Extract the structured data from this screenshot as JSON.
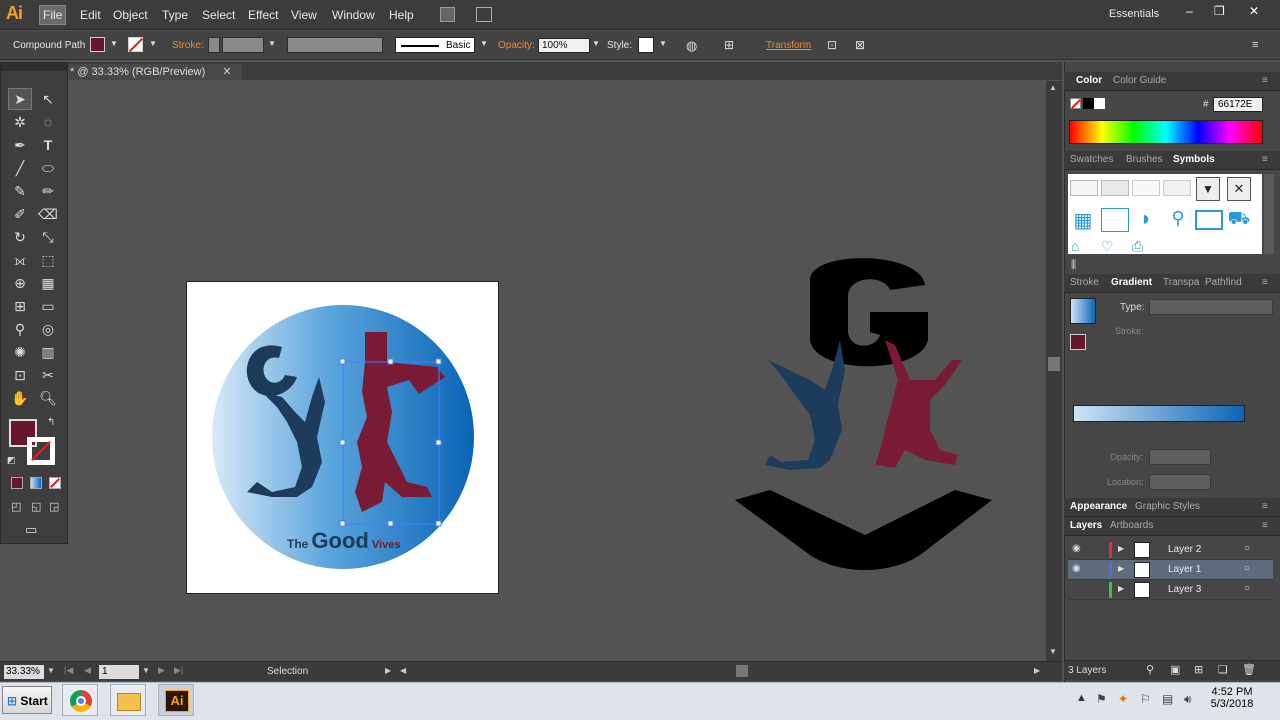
{
  "app": {
    "logo": "Ai"
  },
  "menu": {
    "items": [
      "File",
      "Edit",
      "Object",
      "Type",
      "Select",
      "Effect",
      "View",
      "Window",
      "Help"
    ],
    "workspace": "Essentials"
  },
  "control": {
    "selection_type": "Compound Path",
    "stroke_label": "Stroke:",
    "brush": "Basic",
    "opacity_label": "Opacity:",
    "opacity_value": "100%",
    "style_label": "Style:",
    "transform_label": "Transform"
  },
  "document": {
    "tab_label": "* @ 33.33% (RGB/Preview)"
  },
  "artwork": {
    "logo_text_small": "The",
    "logo_text_big": "Good",
    "logo_text_suffix": "Vives",
    "left_letter": "G",
    "right_letter": "G"
  },
  "color_panel": {
    "tabs": [
      "Color",
      "Color Guide"
    ],
    "hex_label": "#",
    "hex_value": "66172E"
  },
  "symbols_panel": {
    "tabs": [
      "Swatches",
      "Brushes",
      "Symbols"
    ]
  },
  "gradient_panel": {
    "tabs": [
      "Stroke",
      "Gradient",
      "Transpa",
      "Pathfind"
    ],
    "type_label": "Type:",
    "stroke_label": "Stroke:",
    "opacity_label": "Opacity:",
    "location_label": "Location:"
  },
  "appearance_panel": {
    "tabs": [
      "Appearance",
      "Graphic Styles"
    ]
  },
  "layers_panel": {
    "tabs": [
      "Layers",
      "Artboards"
    ],
    "layers": [
      {
        "name": "Layer 2",
        "color": "#e03030",
        "selected": false
      },
      {
        "name": "Layer 1",
        "color": "#4a6cf0",
        "selected": true
      },
      {
        "name": "Layer 3",
        "color": "#3fc040",
        "selected": false
      }
    ],
    "count": "3 Layers"
  },
  "status": {
    "zoom": "33.33%",
    "artboard_index": "1",
    "tool": "Selection"
  },
  "taskbar": {
    "start": "Start",
    "time": "4:52 PM",
    "date": "5/3/2018"
  },
  "colors": {
    "fill": "#66172E",
    "accent": "#f08a24",
    "blue_dark": "#0a65b5",
    "navy": "#1d3b5a"
  }
}
